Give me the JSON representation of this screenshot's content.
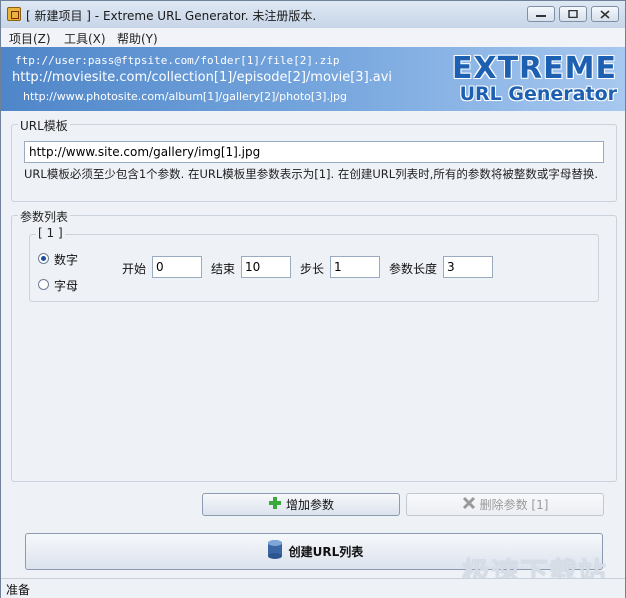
{
  "window": {
    "title": "[ 新建项目 ] - Extreme URL Generator. 未注册版本."
  },
  "menu": {
    "items": [
      "项目(Z)",
      "工具(X)",
      "帮助(Y)"
    ]
  },
  "banner": {
    "line1": "ftp://user:pass@ftpsite.com/folder[1]/file[2].zip",
    "line2": "http://moviesite.com/collection[1]/episode[2]/movie[3].avi",
    "line3": "http://www.photosite.com/album[1]/gallery[2]/photo[3].jpg",
    "brand_top": "EXTREME",
    "brand_bottom": "URL Generator"
  },
  "url_template": {
    "label": "URL模板",
    "value": "http://www.site.com/gallery/img[1].jpg",
    "help": "URL模板必须至少包含1个参数. 在URL模板里参数表示为[1]. 在创建URL列表时,所有的参数将被整数或字母替换."
  },
  "params": {
    "label": "参数列表",
    "group_label": "[ 1 ]",
    "type_number": "数字",
    "type_letter": "字母",
    "selected_type": "数字",
    "start_label": "开始",
    "start_value": "0",
    "end_label": "结束",
    "end_value": "10",
    "step_label": "步长",
    "step_value": "1",
    "length_label": "参数长度",
    "length_value": "3"
  },
  "buttons": {
    "add": "增加参数",
    "delete": "删除参数 [1]",
    "create": "创建URL列表"
  },
  "status": {
    "text": "准备"
  },
  "watermark": "极速下载站",
  "colors": {
    "banner_start": "#4f86c9",
    "brand": "#1d5fb0"
  }
}
